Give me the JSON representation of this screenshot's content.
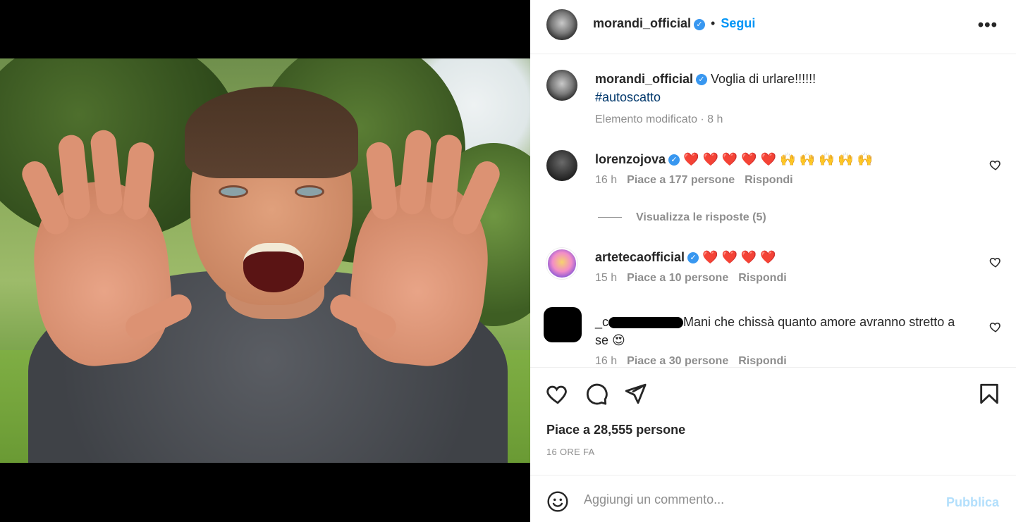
{
  "post": {
    "author": "morandi_official",
    "follow_label": "Segui",
    "dot": "•",
    "more_label": "•••",
    "caption_text": "Voglia di urlare!!!!!!",
    "caption_hashtag": "#autoscatto",
    "caption_meta": "Elemento modificato · 8 h",
    "likes": "Piace a 28,555 persone",
    "time": "16 ORE FA"
  },
  "comments": [
    {
      "user": "lorenzojova",
      "text": "❤️ ❤️ ❤️ ❤️ ❤️ 🙌 🙌 🙌 🙌 🙌",
      "time": "16 h",
      "likes": "Piace a 177 persone",
      "reply": "Rispondi",
      "view_replies": "Visualizza le risposte (5)"
    },
    {
      "user": "artetecaofficial",
      "text": "❤️ ❤️ ❤️ ❤️",
      "time": "15 h",
      "likes": "Piace a 10 persone",
      "reply": "Rispondi"
    },
    {
      "user_prefix": "_c",
      "text_line1": "Mani che chissà quanto amore avranno stretto a",
      "text_line2": "se 😍",
      "time": "16 h",
      "likes": "Piace a 30 persone",
      "reply": "Rispondi"
    }
  ],
  "add_comment": {
    "placeholder": "Aggiungi un commento...",
    "publish_label": "Pubblica"
  },
  "colors": {
    "accent": "#0095f6",
    "verified": "#3897f0",
    "muted": "#8e8e8e",
    "publish_disabled": "#b2dffc"
  }
}
